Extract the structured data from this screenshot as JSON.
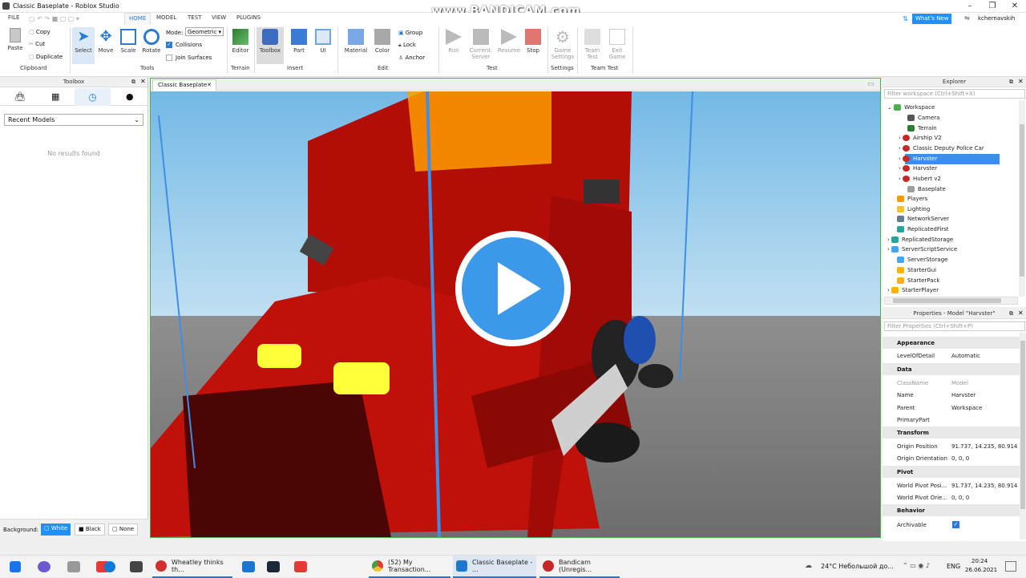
{
  "window": {
    "title": "Classic Baseplate - Roblox Studio"
  },
  "watermark": "www.BANDICAM.com",
  "menu": {
    "file": "FILE",
    "home": "HOME",
    "model": "MODEL",
    "test": "TEST",
    "view": "VIEW",
    "plugins": "PLUGINS"
  },
  "topright": {
    "whats_new": "What's New",
    "user": "kchernavskih"
  },
  "ribbon": {
    "paste": "Paste",
    "copy": "Copy",
    "cut": "Cut",
    "duplicate": "Duplicate",
    "clipboard": "Clipboard",
    "select": "Select",
    "move": "Move",
    "scale": "Scale",
    "rotate": "Rotate",
    "tools": "Tools",
    "mode_label": "Mode:",
    "mode_value": "Geometric",
    "collisions": "Collisions",
    "join_surfaces": "Join Surfaces",
    "editor": "Editor",
    "terrain": "Terrain",
    "toolbox": "Toolbox",
    "part": "Part",
    "ui": "UI",
    "insert": "Insert",
    "material": "Material",
    "color": "Color",
    "group": "Group",
    "lock": "Lock",
    "anchor": "Anchor",
    "edit": "Edit",
    "run": "Run",
    "current_server": "Current:\nServer",
    "resume": "Resume",
    "stop": "Stop",
    "test": "Test",
    "game_settings": "Game\nSettings",
    "settings": "Settings",
    "team_test": "Team\nTest",
    "exit_game": "Exit\nGame",
    "team_test_group": "Team Test"
  },
  "toolbox": {
    "title": "Toolbox",
    "dropdown": "Recent Models",
    "empty": "No results found",
    "background_label": "Background:",
    "bg_white": "White",
    "bg_black": "Black",
    "bg_none": "None"
  },
  "viewport": {
    "tab": "Classic Baseplate"
  },
  "explorer": {
    "title": "Explorer",
    "filter": "Filter workspace (Ctrl+Shift+X)",
    "items": [
      "Workspace",
      "Camera",
      "Terrain",
      "Airship V2",
      "Classic Deputy Police Car",
      "Harvster",
      "Harvster",
      "Hubert v2",
      "Baseplate",
      "Players",
      "Lighting",
      "NetworkServer",
      "ReplicatedFirst",
      "ReplicatedStorage",
      "ServerScriptService",
      "ServerStorage",
      "StarterGui",
      "StarterPack",
      "StarterPlayer"
    ]
  },
  "properties": {
    "title": "Properties - Model \"Harvster\"",
    "filter": "Filter Properties (Ctrl+Shift+P)",
    "cat_appearance": "Appearance",
    "lod_k": "LevelOfDetail",
    "lod_v": "Automatic",
    "cat_data": "Data",
    "class_k": "ClassName",
    "class_v": "Model",
    "name_k": "Name",
    "name_v": "Harvster",
    "parent_k": "Parent",
    "parent_v": "Workspace",
    "primary_k": "PrimaryPart",
    "primary_v": "",
    "cat_transform": "Transform",
    "opos_k": "Origin Position",
    "opos_v": "91.737, 14.235, 80.914",
    "oori_k": "Origin Orientation",
    "oori_v": "0, 0, 0",
    "cat_pivot": "Pivot",
    "wpp_k": "World Pivot Posi...",
    "wpp_v": "91.737, 14.235, 80.914",
    "wpo_k": "World Pivot Orie...",
    "wpo_v": "0, 0, 0",
    "cat_behavior": "Behavior",
    "arch_k": "Archivable"
  },
  "taskbar": {
    "app1": "Wheatley thinks th...",
    "app2": "(52) My Transaction...",
    "app3": "Classic Baseplate - ...",
    "app4": "Bandicam (Unregis...",
    "weather": "24°C  Небольшой до...",
    "lang": "ENG",
    "time": "20:24",
    "date": "26.06.2021"
  },
  "colors": {
    "accent": "#1e90ff",
    "selection": "#3c8fe8",
    "sky": "#8fc6e8",
    "truck_red": "#c0100a"
  }
}
